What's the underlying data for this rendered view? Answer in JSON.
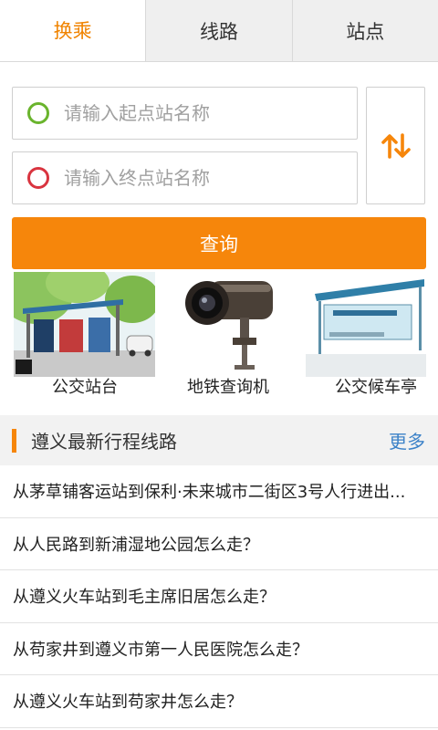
{
  "tabs": [
    {
      "label": "换乘",
      "active": true
    },
    {
      "label": "线路",
      "active": false
    },
    {
      "label": "站点",
      "active": false
    }
  ],
  "search": {
    "start_placeholder": "请输入起点站名称",
    "end_placeholder": "请输入终点站名称",
    "start_value": "",
    "end_value": "",
    "swap_icon": "swap-vertical-arrows-icon",
    "query_label": "查询"
  },
  "categories": [
    {
      "label": "公交站台",
      "image": "bus-stop-street-photo"
    },
    {
      "label": "地铁查询机",
      "image": "security-camera-photo"
    },
    {
      "label": "公交候车亭",
      "image": "bus-shelter-photo"
    }
  ],
  "section": {
    "title": "遵义最新行程线路",
    "more_label": "更多"
  },
  "routes": [
    "从茅草铺客运站到保利·未来城市二街区3号人行进出...",
    "从人民路到新浦湿地公园怎么走？",
    "从遵义火车站到毛主席旧居怎么走？",
    "从苟家井到遵义市第一人民医院怎么走？",
    "从遵义火车站到苟家井怎么走？"
  ],
  "colors": {
    "accent": "#f6860b",
    "start_dot": "#6ab42d",
    "end_dot": "#d9343f",
    "link": "#3c82c8"
  }
}
